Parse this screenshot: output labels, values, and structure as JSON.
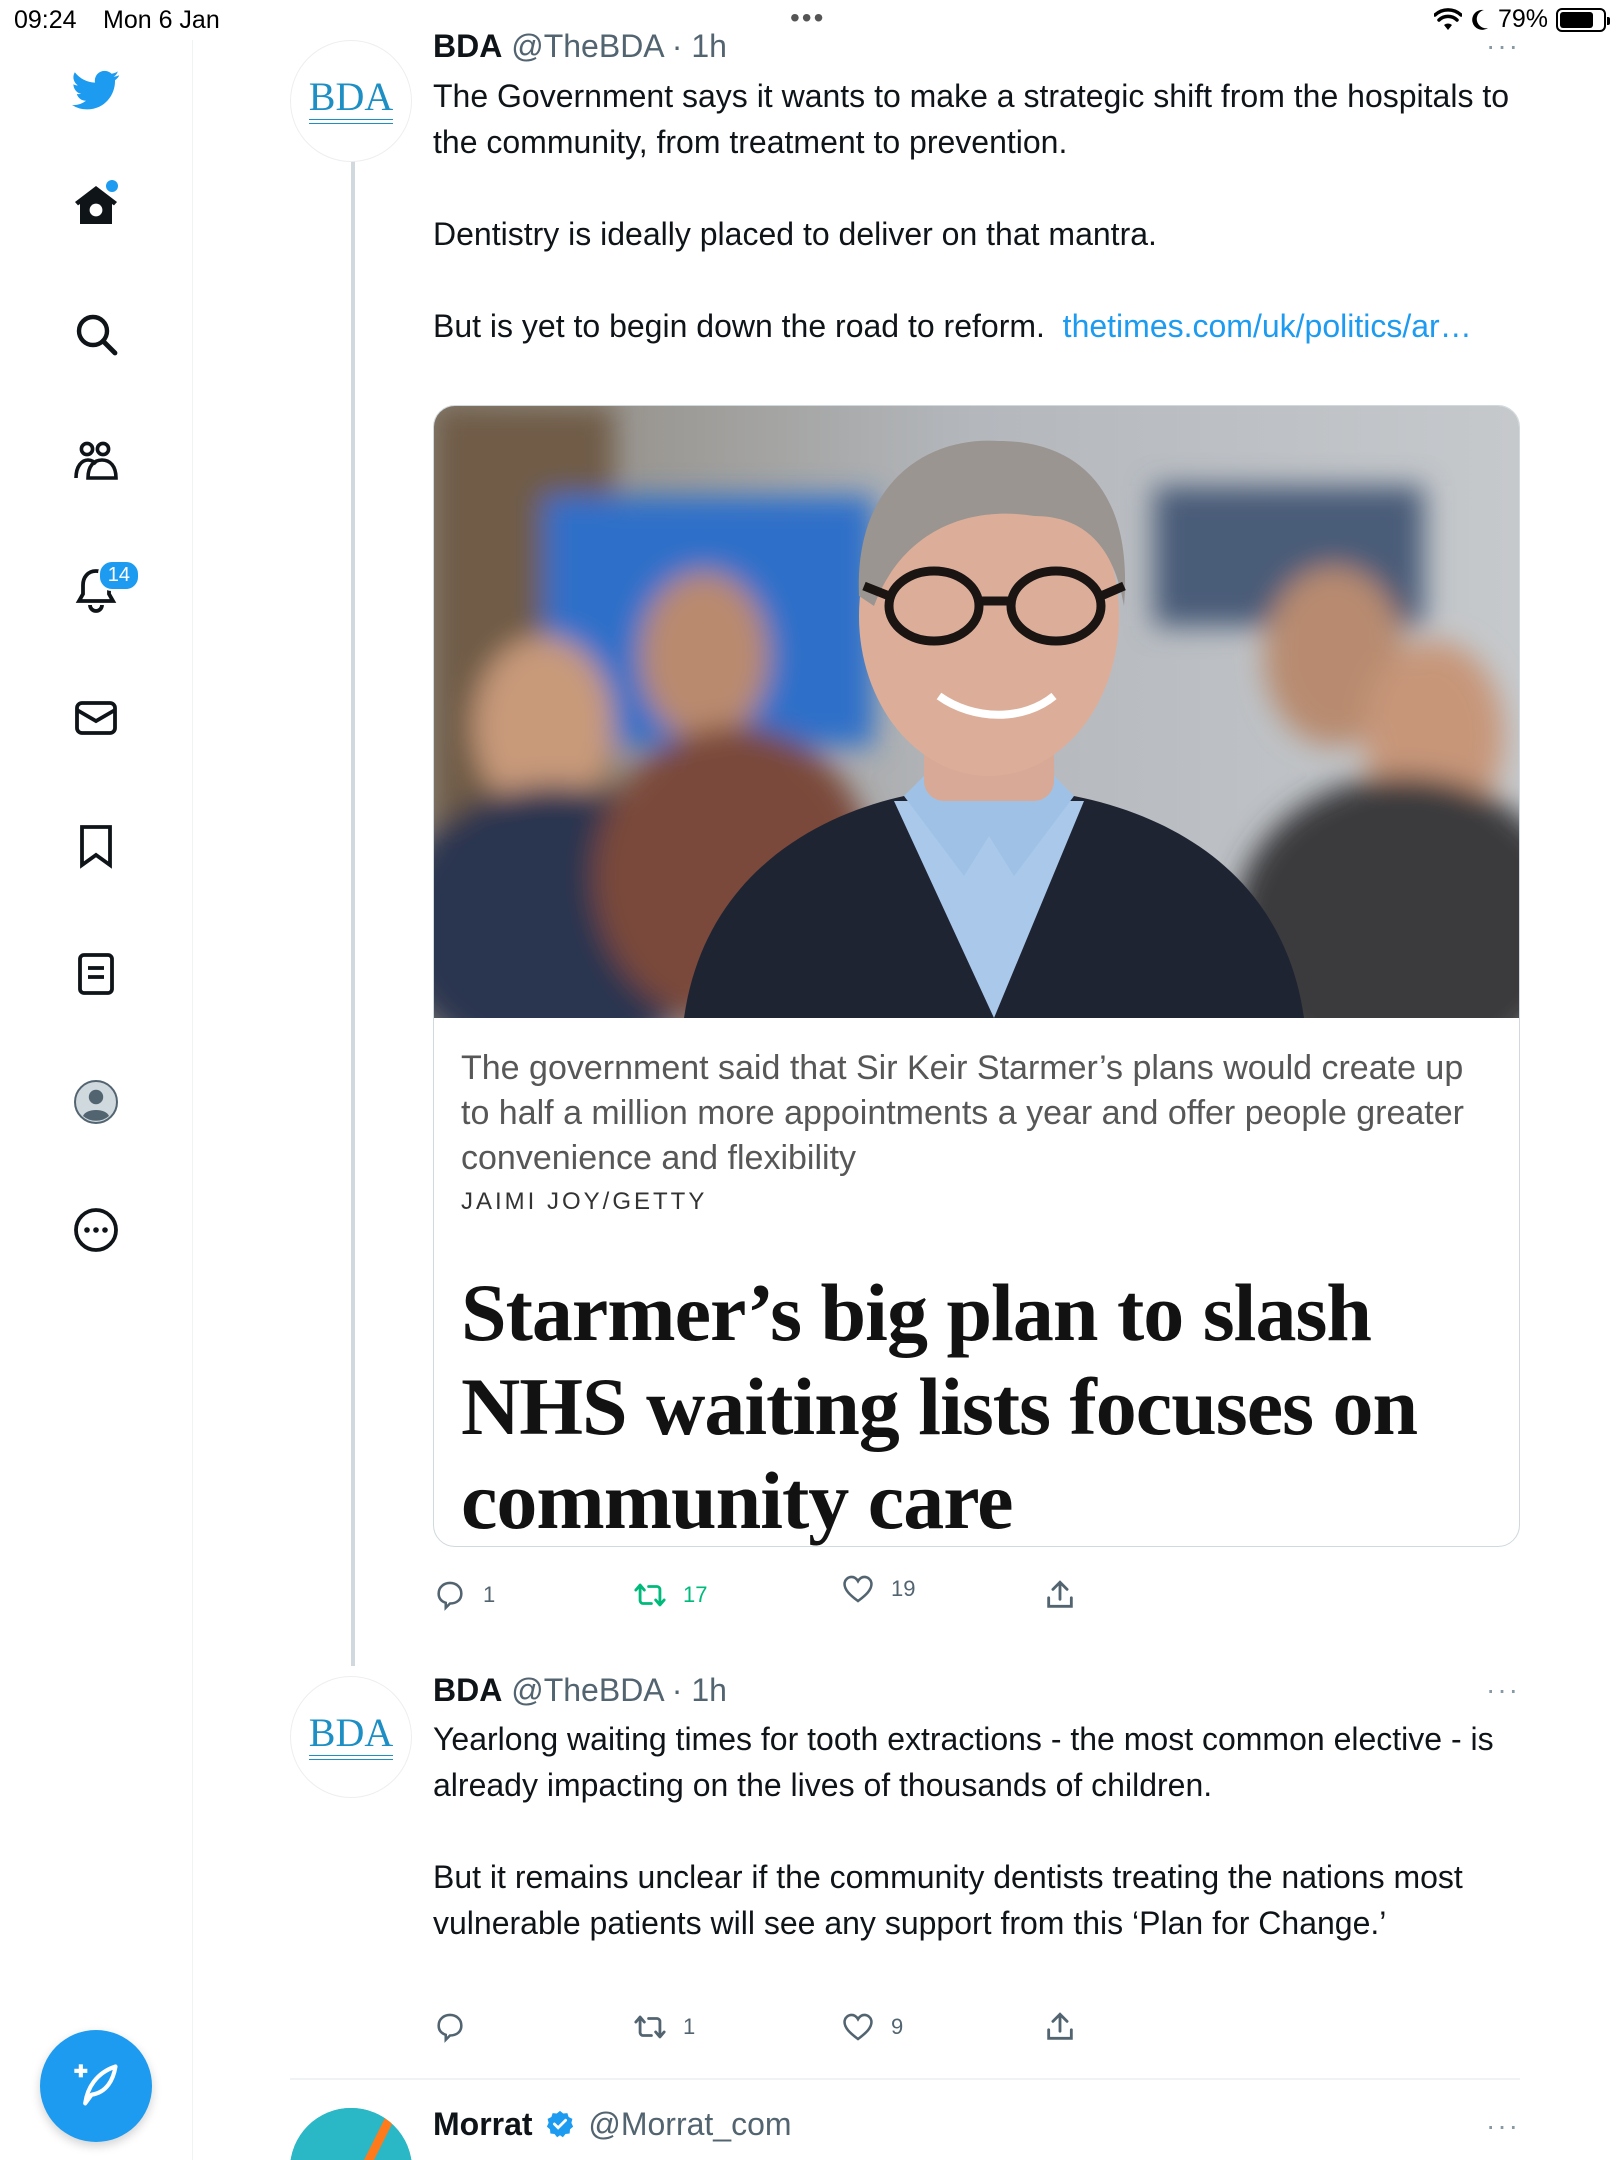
{
  "status_bar": {
    "time": "09:24",
    "date": "Mon 6 Jan",
    "battery": "79%",
    "battery_level": 0.79
  },
  "sidebar": {
    "items": [
      {
        "name": "logo",
        "icon": "twitter-bird-icon"
      },
      {
        "name": "home",
        "icon": "home-icon",
        "has_dot": true
      },
      {
        "name": "explore",
        "icon": "search-icon"
      },
      {
        "name": "communities",
        "icon": "communities-icon"
      },
      {
        "name": "notifications",
        "icon": "bell-icon",
        "badge": "14"
      },
      {
        "name": "messages",
        "icon": "mail-icon"
      },
      {
        "name": "bookmarks",
        "icon": "bookmark-icon"
      },
      {
        "name": "lists",
        "icon": "lists-icon"
      },
      {
        "name": "profile",
        "icon": "avatar-icon"
      },
      {
        "name": "more",
        "icon": "more-circle-icon"
      }
    ],
    "compose_icon": "compose-feather-icon"
  },
  "tweets": [
    {
      "name": "BDA",
      "handle": "@TheBDA · 1h",
      "avatar_text": "BDA",
      "paragraphs": [
        "The Government says it wants to make a strategic shift from the hospitals to the community, from treatment to prevention.",
        "Dentistry is ideally placed to deliver on that mantra."
      ],
      "last_paragraph_text": "But is yet to begin down the road to reform.",
      "link": "thetimes.com/uk/politics/ar…",
      "card": {
        "caption": "The government said that Sir Keir Starmer’s plans would create up to half a million more appointments a year and offer people greater convenience and flexibility",
        "credit": "JAIMI JOY/GETTY",
        "headline": "Starmer’s big plan to slash NHS waiting lists focuses on community care"
      },
      "stats": {
        "replies": "1",
        "retweets": "17",
        "likes": "19"
      }
    },
    {
      "name": "BDA",
      "handle": "@TheBDA · 1h",
      "avatar_text": "BDA",
      "paragraphs": [
        "Yearlong waiting times for tooth extractions - the most common elective - is already impacting on the lives of thousands of children.",
        "But it remains unclear if the community dentists treating the nations most vulnerable patients will see any support from this ‘Plan for Change.’"
      ],
      "stats": {
        "replies": "",
        "retweets": "1",
        "likes": "9"
      }
    },
    {
      "name": "Morrat",
      "handle": "@Morrat_com",
      "verified": true
    }
  ],
  "more_glyph": "···",
  "colors": {
    "accent": "#1d9bf0",
    "retweet": "#00ba7c",
    "text": "#0f1419",
    "muted": "#536471"
  }
}
